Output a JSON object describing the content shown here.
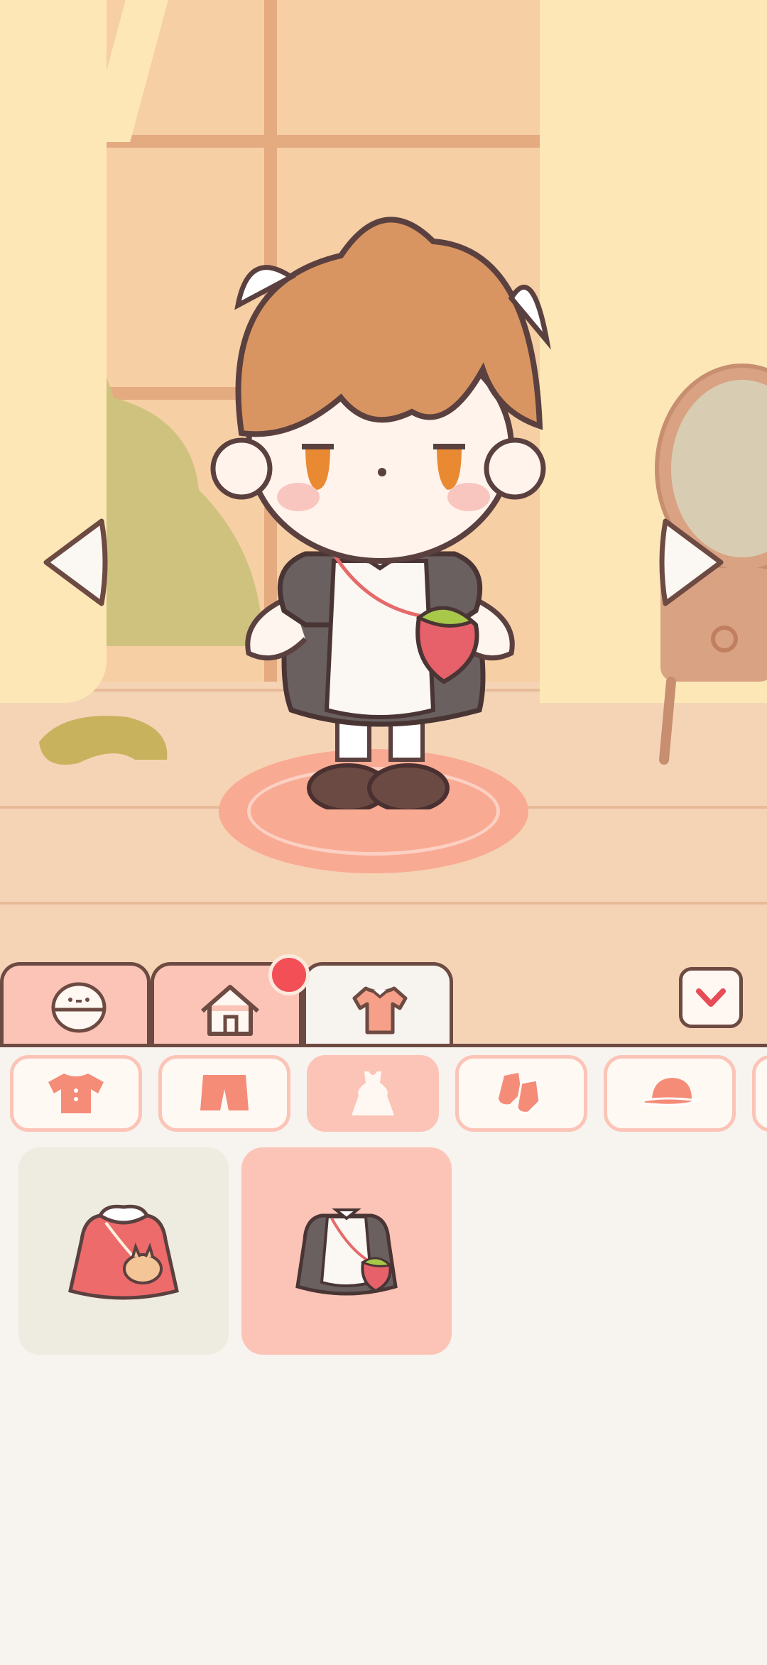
{
  "app": {
    "name": "dress-up"
  },
  "main_tabs": [
    {
      "id": "face",
      "icon": "face-icon",
      "active": false
    },
    {
      "id": "home",
      "icon": "house-icon",
      "active": false,
      "notification": true
    },
    {
      "id": "clothes",
      "icon": "shirt-icon",
      "active": true
    }
  ],
  "subcategories": [
    {
      "id": "tops",
      "icon": "shirt-icon",
      "active": false
    },
    {
      "id": "bottoms",
      "icon": "shorts-icon",
      "active": false
    },
    {
      "id": "dresses",
      "icon": "dress-icon",
      "active": true
    },
    {
      "id": "shoes",
      "icon": "socks-icon",
      "active": false
    },
    {
      "id": "hats",
      "icon": "cap-icon",
      "active": false
    }
  ],
  "items": [
    {
      "id": "pink-dress-bunny-bag",
      "icon": "pink-dress-icon",
      "selected": false
    },
    {
      "id": "maid-dress-strawberry-bag",
      "icon": "maid-dress-icon",
      "selected": true
    }
  ],
  "colors": {
    "accent": "#fcc4b7",
    "outline": "#6d4a42",
    "notification": "#f24f57",
    "panel_bg": "#f7f3ee"
  }
}
